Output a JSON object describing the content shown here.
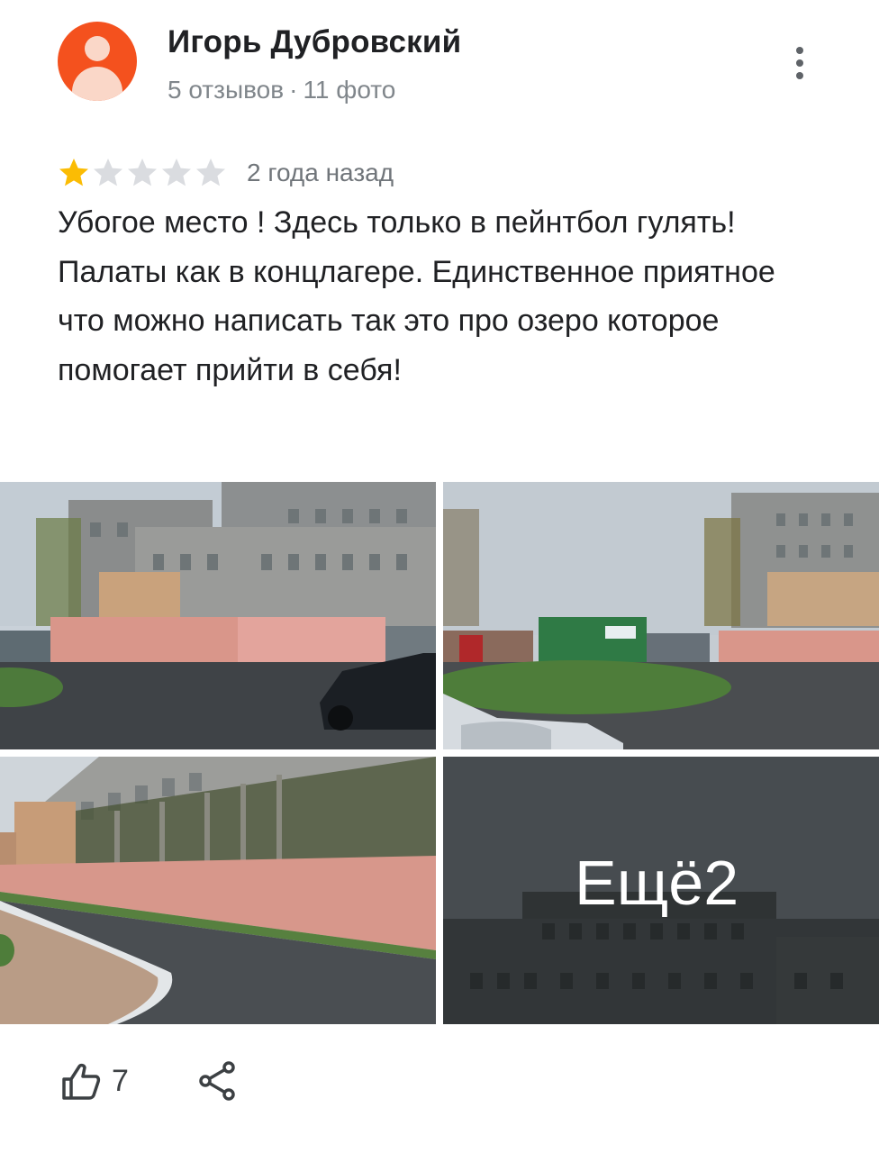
{
  "author": {
    "name": "Игорь Дубровский",
    "reviews_count": "5 отзывов",
    "separator": "·",
    "photos_count": "11 фото",
    "avatar_color": "#f4511e"
  },
  "review": {
    "rating": 1,
    "max_rating": 5,
    "star_color_filled": "#fbbc04",
    "star_color_empty": "#dadce0",
    "time": "2 года назад",
    "text": "Убогое место ! Здесь только в пейнтбол гулять! Палаты как в концлагере. Единственное приятное что можно написать так это про озеро которое помогает прийти в себя!"
  },
  "photos": {
    "more_label": "Ещё2"
  },
  "actions": {
    "like_count": "7",
    "like_icon": "thumb-up-icon",
    "share_icon": "share-icon",
    "more_icon": "more-vert-icon"
  }
}
